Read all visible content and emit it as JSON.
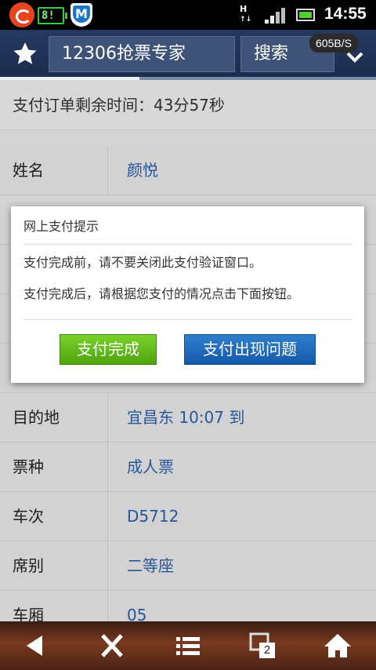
{
  "status_bar": {
    "battery_badge": "8!",
    "shield_letter": "M",
    "network": "H",
    "time": "14:55"
  },
  "toolbar": {
    "url": "12306抢票专家",
    "search_label": "搜索",
    "speed": "605B/S",
    "page_load_progress": 0.37
  },
  "page": {
    "countdown": "支付订单剩余时间：43分57秒",
    "rows": [
      {
        "label": "姓名",
        "value": "颜悦"
      },
      {
        "label": "目的地",
        "value": "宜昌东  10:07 到"
      },
      {
        "label": "票种",
        "value": "成人票"
      },
      {
        "label": "车次",
        "value": "D5712"
      },
      {
        "label": "席别",
        "value": "二等座"
      },
      {
        "label": "车厢",
        "value": "05"
      }
    ]
  },
  "dialog": {
    "title": "网上支付提示",
    "line1": "支付完成前，请不要关闭此支付验证窗口。",
    "line2": "支付完成后，请根据您支付的情况点击下面按钮。",
    "done_label": "支付完成",
    "problem_label": "支付出现问题"
  },
  "bottom_nav": {
    "tab_count": "2"
  },
  "colors": {
    "toolbar": "#1b2c4d",
    "value_text": "#2b5ea8",
    "done_button": "#5cb81a",
    "problem_button": "#1f6cbd"
  }
}
